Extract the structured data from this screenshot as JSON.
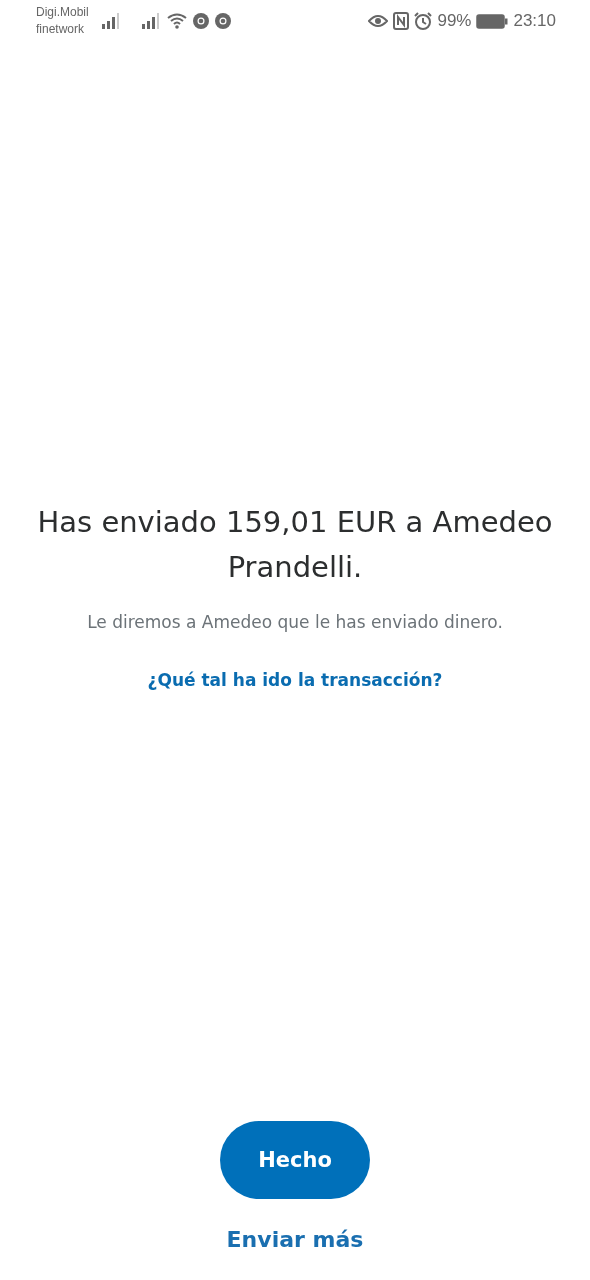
{
  "status_bar": {
    "carrier": [
      "Digi.Mobil",
      "finetwork"
    ],
    "battery": "99%",
    "time": "23:10"
  },
  "confirmation": {
    "heading": "Has enviado 159,01 EUR a Amedeo Prandelli.",
    "subtitle": "Le diremos a Amedeo que le has enviado dinero.",
    "feedback_link": "¿Qué tal ha ido la transacción?"
  },
  "actions": {
    "primary": "Hecho",
    "secondary": "Enviar más"
  }
}
